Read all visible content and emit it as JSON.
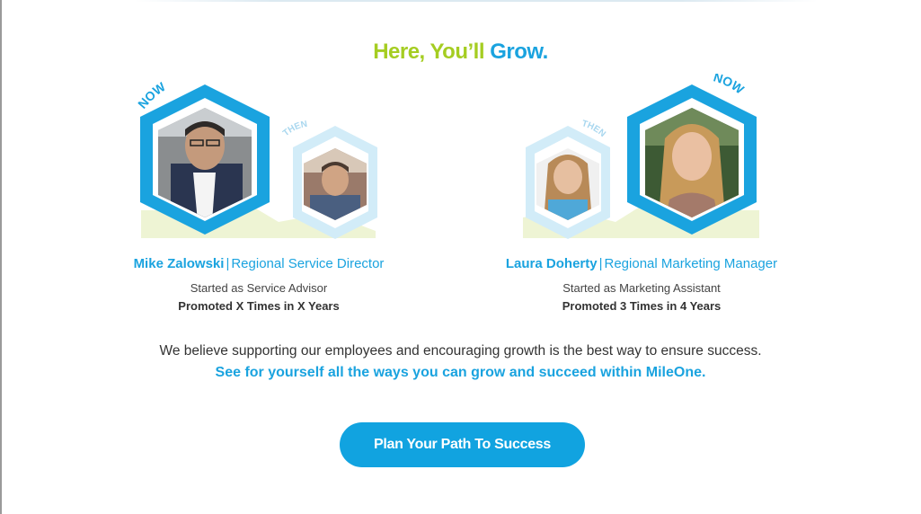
{
  "headline": {
    "part1": "Here, You’ll",
    "part2": "Grow."
  },
  "people": [
    {
      "now_label": "NOW",
      "then_label": "THEN",
      "name": "Mike Zalowski",
      "separator": "|",
      "title": "Regional Service Director",
      "started": "Started as Service Advisor",
      "promoted": "Promoted X Times in X Years"
    },
    {
      "now_label": "NOW",
      "then_label": "THEN",
      "name": "Laura Doherty",
      "separator": "|",
      "title": "Regional Marketing Manager",
      "started": "Started as Marketing Assistant",
      "promoted": "Promoted 3 Times in 4 Years"
    }
  ],
  "body": {
    "belief": "We believe supporting our employees and encouraging growth is the best way to ensure success.",
    "see_yourself": "See for yourself all the ways you can grow and succeed within MileOne."
  },
  "cta": {
    "label": "Plan Your Path To Success"
  },
  "colors": {
    "accent_blue": "#1aa3df",
    "accent_green": "#a5cd22",
    "light_blue": "#d2ecf8"
  }
}
